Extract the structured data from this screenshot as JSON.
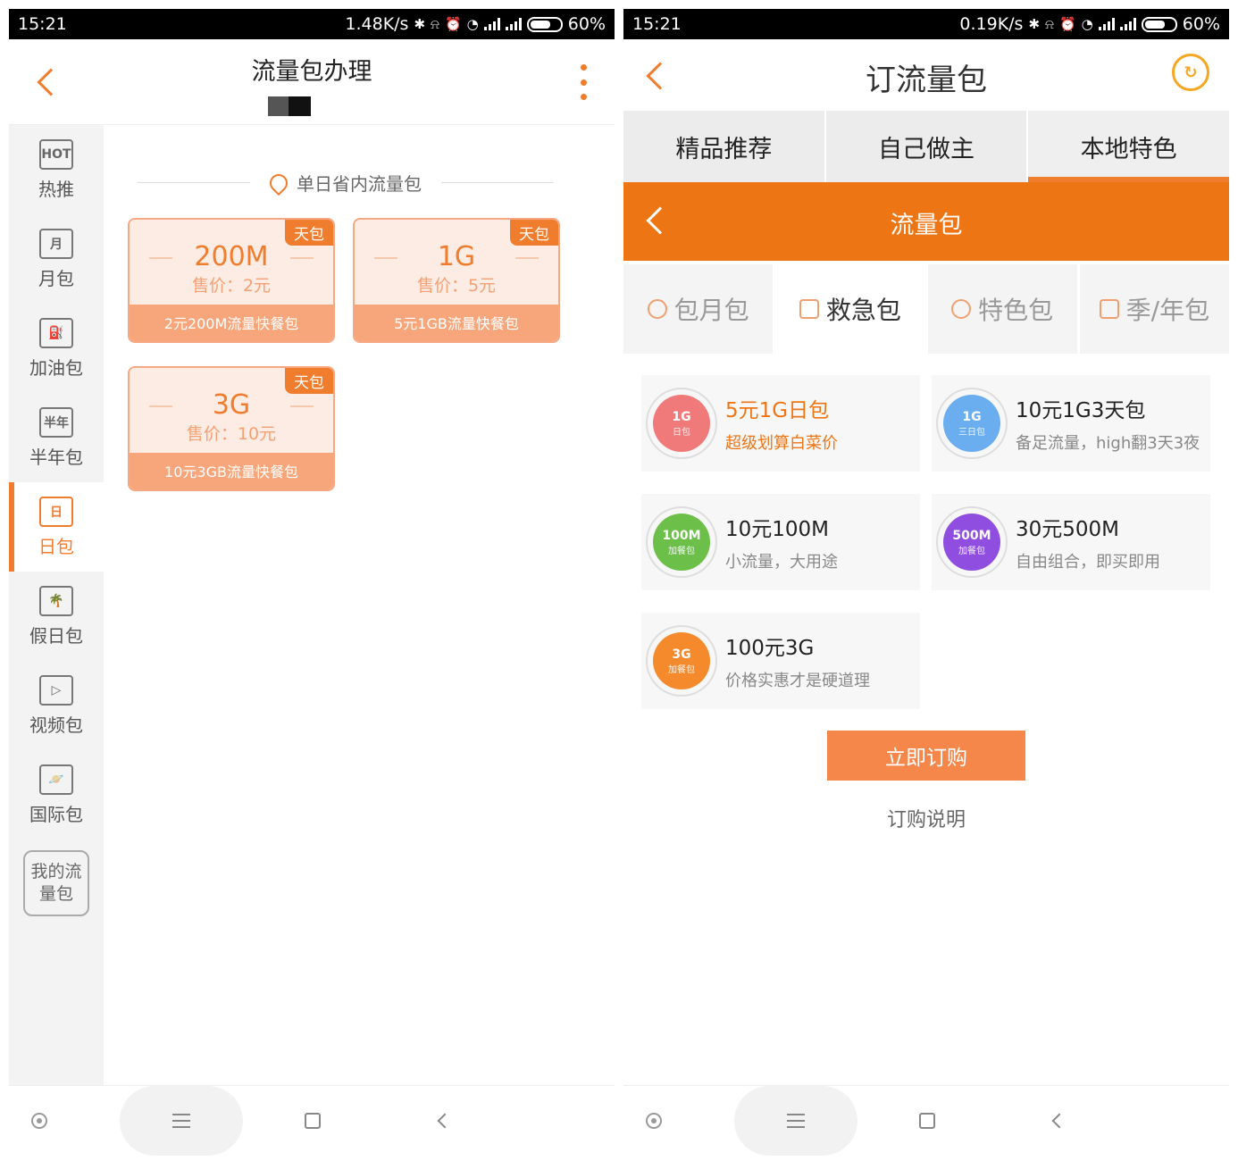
{
  "left": {
    "status": {
      "time": "15:21",
      "speed": "1.48K/s",
      "battery": "60%"
    },
    "header": {
      "title": "流量包办理"
    },
    "sidebar": [
      {
        "label": "热推",
        "icon": "HOT"
      },
      {
        "label": "月包",
        "icon": "月"
      },
      {
        "label": "加油包",
        "icon": "⛽"
      },
      {
        "label": "半年包",
        "icon": "半年"
      },
      {
        "label": "日包",
        "icon": "日"
      },
      {
        "label": "假日包",
        "icon": "🌴"
      },
      {
        "label": "视频包",
        "icon": "▷"
      },
      {
        "label": "国际包",
        "icon": "🪐"
      }
    ],
    "sidebar_active_index": 4,
    "my_packages": "我的流量包",
    "section_title": "单日省内流量包",
    "packages": [
      {
        "tag": "天包",
        "size": "200M",
        "price": "售价：2元",
        "name": "2元200M流量快餐包"
      },
      {
        "tag": "天包",
        "size": "1G",
        "price": "售价：5元",
        "name": "5元1GB流量快餐包"
      },
      {
        "tag": "天包",
        "size": "3G",
        "price": "售价：10元",
        "name": "10元3GB流量快餐包"
      }
    ]
  },
  "right": {
    "status": {
      "time": "15:21",
      "speed": "0.19K/s",
      "battery": "60%"
    },
    "header": {
      "title": "订流量包"
    },
    "top_tabs": [
      "精品推荐",
      "自己做主",
      "本地特色"
    ],
    "top_tab_active": 2,
    "orange_title": "流量包",
    "sub_tabs": [
      "包月包",
      "救急包",
      "特色包",
      "季/年包"
    ],
    "sub_tab_active": 1,
    "products": [
      {
        "badge": "1G",
        "badge_sub": "日包",
        "name": "5元1G日包",
        "desc": "超级划算白菜价",
        "color": "#f07a7a"
      },
      {
        "badge": "1G",
        "badge_sub": "三日包",
        "name": "10元1G3天包",
        "desc": "备足流量，high翻3天3夜",
        "color": "#6aaef0"
      },
      {
        "badge": "100M",
        "badge_sub": "加餐包",
        "name": "10元100M",
        "desc": "小流量，大用途",
        "color": "#6cc04a"
      },
      {
        "badge": "500M",
        "badge_sub": "加餐包",
        "name": "30元500M",
        "desc": "自由组合，即买即用",
        "color": "#8f4ee0"
      },
      {
        "badge": "3G",
        "badge_sub": "加餐包",
        "name": "100元3G",
        "desc": "价格实惠才是硬道理",
        "color": "#f58a2c"
      }
    ],
    "buy_button": "立即订购",
    "buy_note": "订购说明"
  }
}
